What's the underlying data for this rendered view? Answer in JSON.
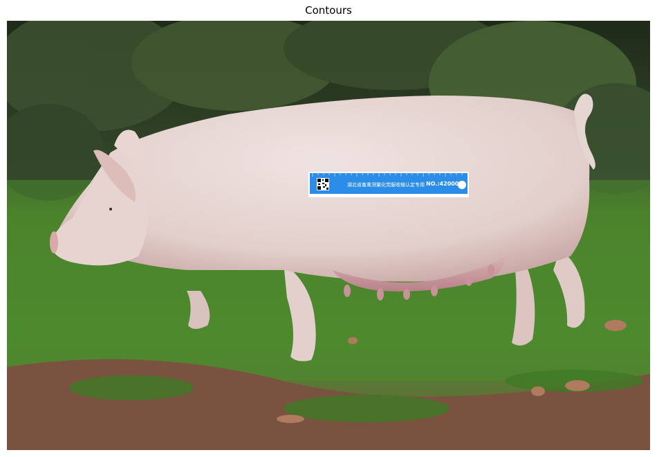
{
  "figure": {
    "title": "Contours"
  },
  "ruler": {
    "caption": "湖北省畜禽测量化党服收输认定专用",
    "serial": "NO.:420001"
  },
  "colors": {
    "ruler_blue": "#2b8de8",
    "grass": "#4f8a2f",
    "foliage": "#2f3d22",
    "pig": "#e8d8d3",
    "soil": "#7a5240"
  }
}
